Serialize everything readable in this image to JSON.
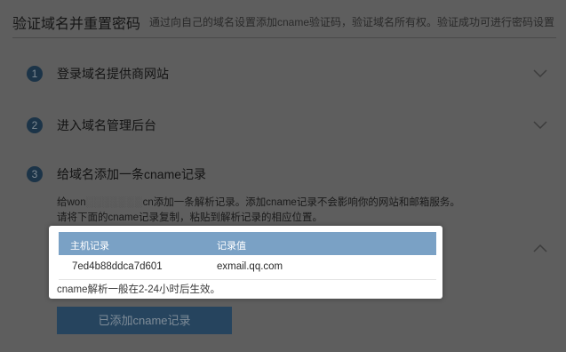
{
  "header": {
    "title": "验证域名并重置密码",
    "description": "通过向自己的域名设置添加cname验证码，验证域名所有权。验证成功可进行密码设置"
  },
  "steps": [
    {
      "number": "1",
      "label": "登录域名提供商网站",
      "state": "collapsed",
      "icon": "chevron-down-icon"
    },
    {
      "number": "2",
      "label": "进入域名管理后台",
      "state": "collapsed",
      "icon": "chevron-down-icon"
    },
    {
      "number": "3",
      "label": "给域名添加一条cname记录",
      "state": "expanded",
      "icon": "chevron-up-icon",
      "description_line1": {
        "prefix": "给won",
        "redacted": "░░░░░░░",
        "suffix": "cn添加一条解析记录。添加cname记录不会影响你的网站和邮箱服务。"
      },
      "description_line2": "请将下面的cname记录复制，粘贴到解析记录的相应位置。"
    }
  ],
  "cname_table": {
    "columns": [
      "主机记录",
      "记录值"
    ],
    "rows": [
      [
        "7ed4b88ddca7d601",
        "exmail.qq.com"
      ]
    ]
  },
  "note": "cname解析一般在2-24小时后生效。",
  "done_button": {
    "label": "已添加cname记录"
  },
  "colors": {
    "overlay_background": "#5e5e5e",
    "step_number_bg": "#1c3448",
    "table_header_bg": "#7aa1c5",
    "button_bg": "#26445e"
  }
}
